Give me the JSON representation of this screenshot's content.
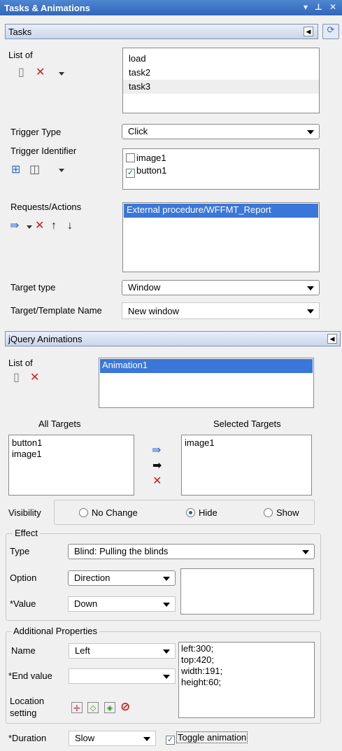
{
  "window": {
    "title": "Tasks & Animations",
    "dropdown_glyph": "▾",
    "pin_glyph": "⊥",
    "close_glyph": "✕"
  },
  "tasks": {
    "header": "Tasks",
    "collapse_glyph": "◀",
    "list_label": "List of",
    "items": [
      "load",
      "task2",
      "task3"
    ],
    "trigger_type_label": "Trigger Type",
    "trigger_type_value": "Click",
    "trigger_identifier_label": "Trigger Identifier",
    "identifiers": [
      {
        "label": "image1",
        "checked": false
      },
      {
        "label": "button1",
        "checked": true
      }
    ],
    "requests_label": "Requests/Actions",
    "requests": [
      "External procedure/WFFMT_Report"
    ],
    "target_type_label": "Target type",
    "target_type_value": "Window",
    "target_name_label": "Target/Template Name",
    "target_name_value": "New window"
  },
  "jquery": {
    "header": "jQuery Animations",
    "list_label": "List of",
    "animations": [
      "Animation1"
    ],
    "all_targets_label": "All Targets",
    "all_targets": [
      "button1",
      "image1"
    ],
    "selected_targets_label": "Selected Targets",
    "selected_targets": [
      "image1"
    ],
    "visibility_label": "Visibility",
    "visibility_options": [
      "No Change",
      "Hide",
      "Show"
    ],
    "visibility_selected": "Hide",
    "effect_label": "Effect",
    "type_label": "Type",
    "type_value": "Blind: Pulling the blinds",
    "option_label": "Option",
    "option_value": "Direction",
    "value_label": "*Value",
    "value_value": "Down",
    "additional_label": "Additional Properties",
    "name_label": "Name",
    "name_value": "Left",
    "end_value_label": "*End value",
    "end_value_value": "",
    "location_label_1": "Location",
    "location_label_2": "setting",
    "css_lines": [
      "left:300;",
      "top:420;",
      "width:191;",
      "height:60;"
    ],
    "duration_label": "*Duration",
    "duration_value": "Slow",
    "toggle_label": "Toggle animation",
    "toggle_checked": true
  },
  "colors": {
    "title_bar": "#3d74c6",
    "selection": "#3b77d8",
    "delete_red": "#d01a1a"
  }
}
